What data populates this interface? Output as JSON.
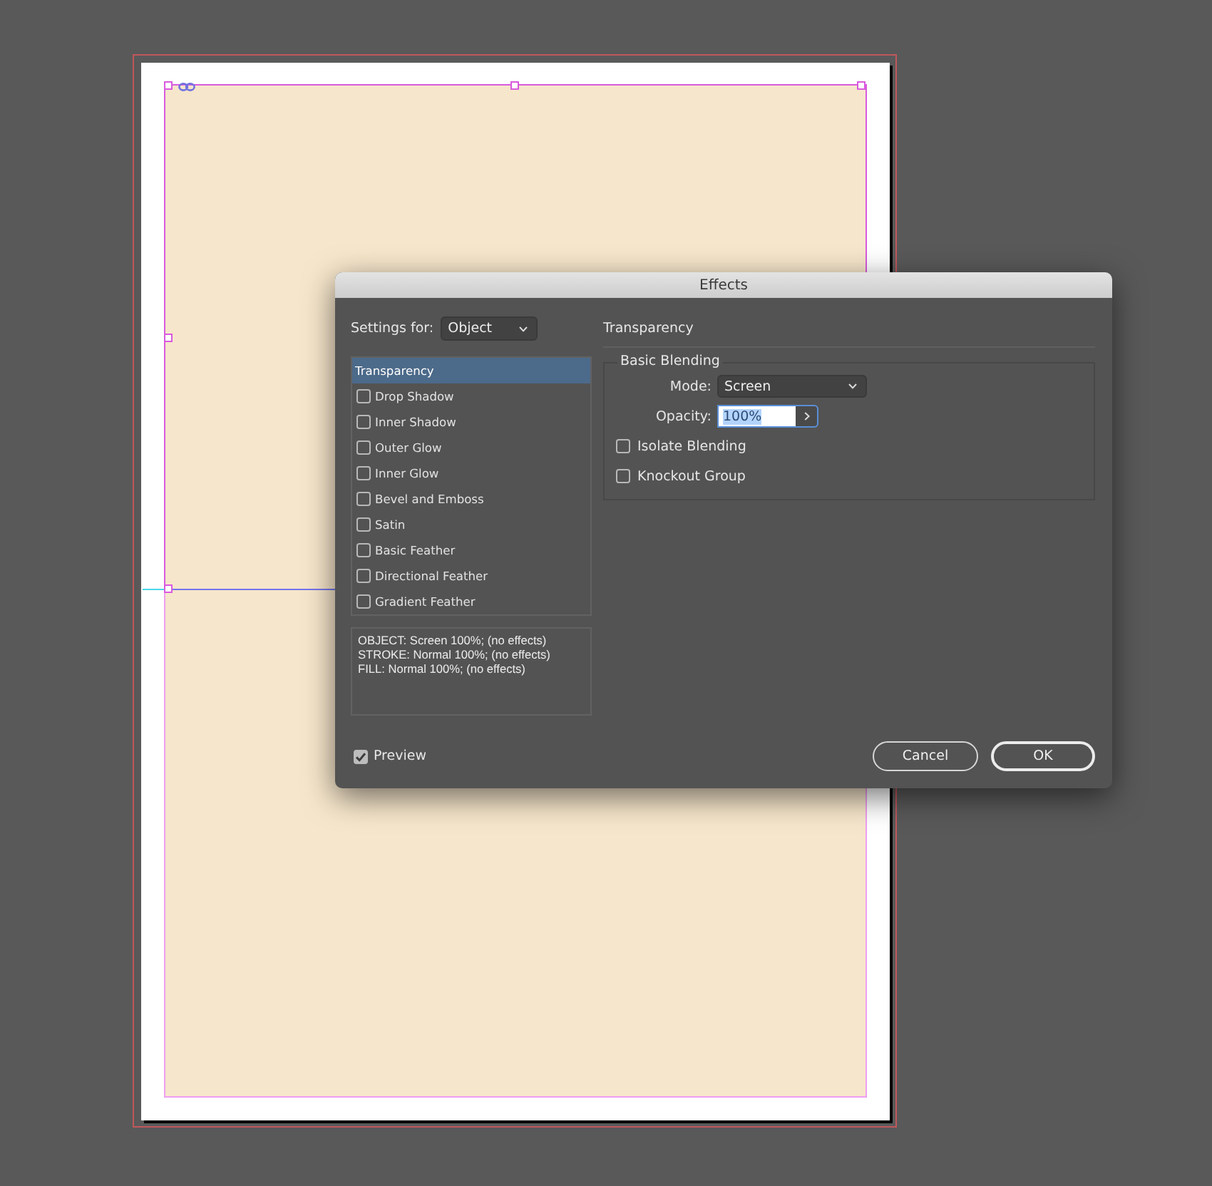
{
  "dialog": {
    "title": "Effects"
  },
  "settings_for": {
    "label": "Settings for:",
    "value": "Object"
  },
  "effects_list": [
    {
      "label": "Transparency",
      "kind": "plain",
      "selected": true
    },
    {
      "label": "Drop Shadow",
      "kind": "checkbox",
      "checked": false,
      "selected": false
    },
    {
      "label": "Inner Shadow",
      "kind": "checkbox",
      "checked": false,
      "selected": false
    },
    {
      "label": "Outer Glow",
      "kind": "checkbox",
      "checked": false,
      "selected": false
    },
    {
      "label": "Inner Glow",
      "kind": "checkbox",
      "checked": false,
      "selected": false
    },
    {
      "label": "Bevel and Emboss",
      "kind": "checkbox",
      "checked": false,
      "selected": false
    },
    {
      "label": "Satin",
      "kind": "checkbox",
      "checked": false,
      "selected": false
    },
    {
      "label": "Basic Feather",
      "kind": "checkbox",
      "checked": false,
      "selected": false
    },
    {
      "label": "Directional Feather",
      "kind": "checkbox",
      "checked": false,
      "selected": false
    },
    {
      "label": "Gradient Feather",
      "kind": "checkbox",
      "checked": false,
      "selected": false
    }
  ],
  "summary": [
    "OBJECT: Screen 100%; (no effects)",
    "STROKE: Normal 100%; (no effects)",
    "FILL: Normal 100%; (no effects)"
  ],
  "preview": {
    "label": "Preview",
    "checked": true
  },
  "panel": {
    "heading": "Transparency",
    "group": "Basic Blending",
    "mode": {
      "label": "Mode:",
      "value": "Screen"
    },
    "opacity": {
      "label": "Opacity:",
      "value": "100%",
      "text_selected": true
    },
    "options": [
      {
        "label": "Isolate Blending",
        "checked": false
      },
      {
        "label": "Knockout Group",
        "checked": false
      }
    ]
  },
  "buttons": [
    {
      "label": "Cancel",
      "default": false
    },
    {
      "label": "OK",
      "default": true
    }
  ]
}
